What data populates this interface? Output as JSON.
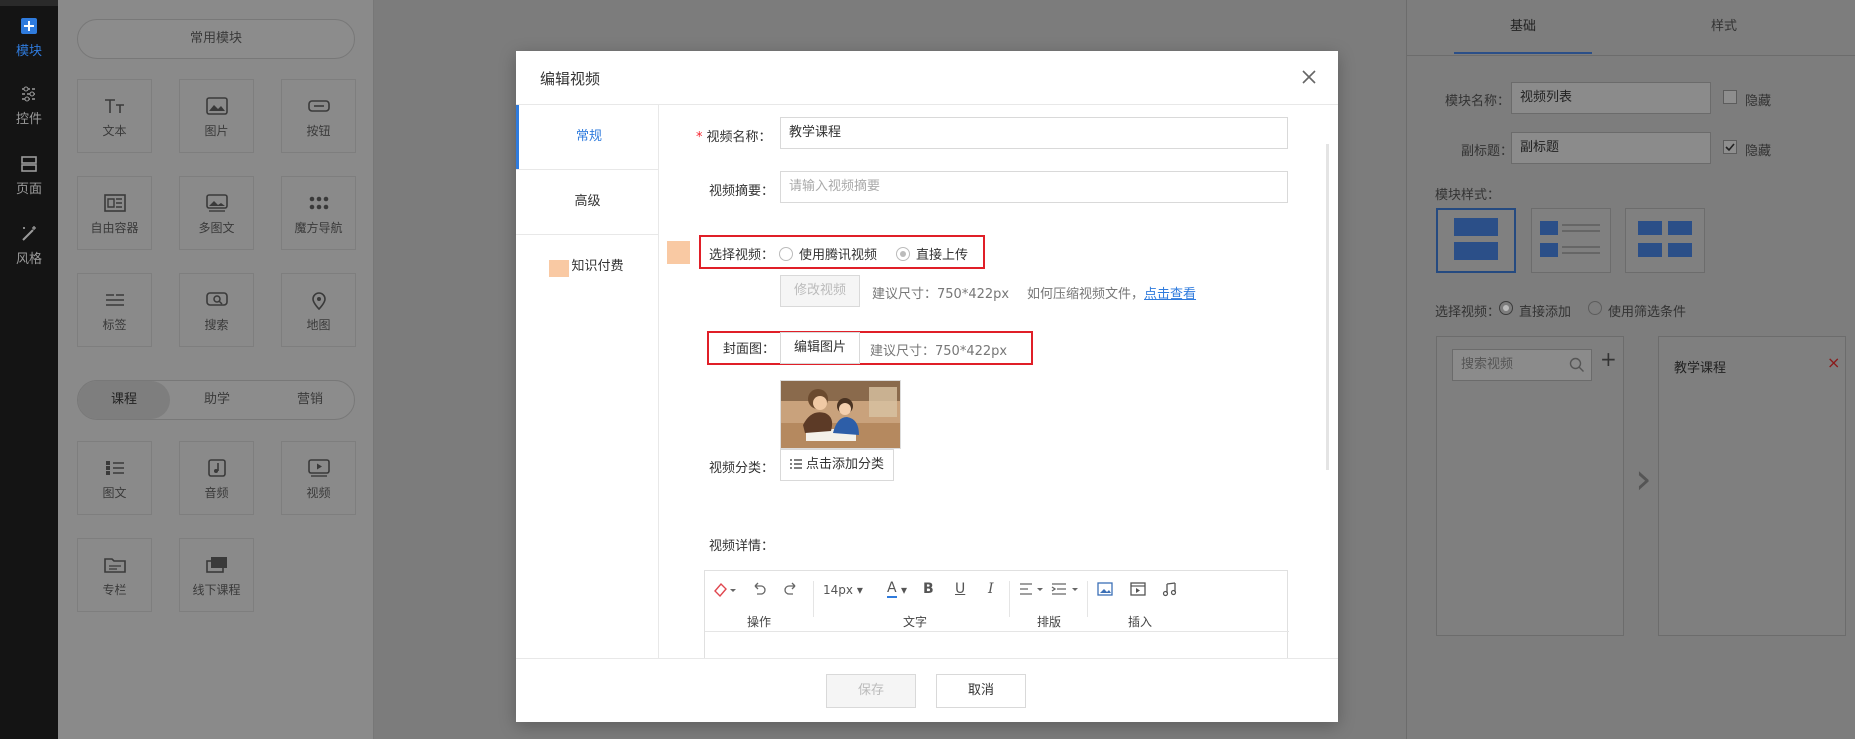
{
  "leftnav": {
    "items": [
      {
        "label": "模块",
        "icon": "plus-square-icon",
        "active": true
      },
      {
        "label": "控件",
        "icon": "sliders-icon"
      },
      {
        "label": "页面",
        "icon": "layout-icon"
      },
      {
        "label": "风格",
        "icon": "magic-wand-icon"
      }
    ]
  },
  "panel": {
    "common_title": "常用模块",
    "common_tiles": [
      "文本",
      "图片",
      "按钮",
      "自由容器",
      "多图文",
      "魔方导航",
      "标签",
      "搜索",
      "地图"
    ],
    "tabs": [
      "课程",
      "助学",
      "营销"
    ],
    "course_tiles": [
      "图文",
      "音频",
      "视频",
      "专栏",
      "线下课程"
    ]
  },
  "right": {
    "tabs": [
      "基础",
      "样式"
    ],
    "module_name_label": "模块名称：",
    "module_name_value": "视频列表",
    "hide_label": "隐藏",
    "subtitle_label": "副标题：",
    "subtitle_value": "副标题",
    "hide_label2": "隐藏",
    "style_label": "模块样式：",
    "select_label": "选择视频：",
    "direct_add": "直接添加",
    "use_filter": "使用筛选条件",
    "search_placeholder": "搜索视频",
    "add_symbol": "+",
    "selected_item": "教学课程",
    "remove_symbol": "×",
    "arrow_symbol": "›"
  },
  "modal": {
    "title": "编辑视频",
    "close_symbol": "×",
    "tabs": [
      "常规",
      "高级",
      "知识付费"
    ],
    "required_mark": "*",
    "name_label": "视频名称：",
    "name_value": "教学课程",
    "summary_label": "视频摘要：",
    "summary_placeholder": "请输入视频摘要",
    "select_label": "选择视频：",
    "option_tencent": "使用腾讯视频",
    "option_upload": "直接上传",
    "modify_video": "修改视频",
    "size_hint": "建议尺寸：750*422px",
    "compress_hint": "如何压缩视频文件，",
    "compress_link": "点击查看",
    "cover_label": "封面图：",
    "edit_image": "编辑图片",
    "cover_hint": "建议尺寸：750*422px",
    "category_label": "视频分类：",
    "category_button": "点击添加分类",
    "detail_label": "视频详情：",
    "editor": {
      "font_size": "14px",
      "bold": "B",
      "underline": "U",
      "italic": "I",
      "color_letter": "A",
      "groups": [
        "操作",
        "文字",
        "排版",
        "插入"
      ]
    },
    "save": "保存",
    "cancel": "取消",
    "accent": "#2f7bdd",
    "highlight": "#e01f28"
  }
}
